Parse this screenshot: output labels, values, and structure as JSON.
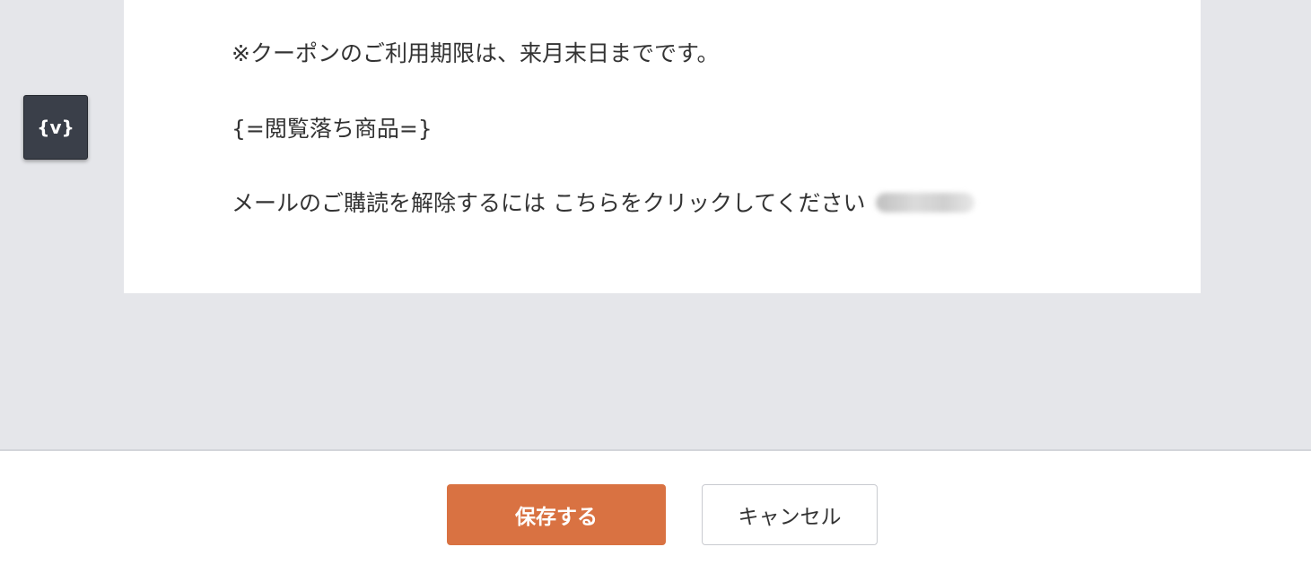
{
  "editor": {
    "variable_button_label": "{v}",
    "body": {
      "coupon_note": "※クーポンのご利用期限は、来月末日までです。",
      "browsed_products_tag": "{=閲覧落ち商品=}",
      "unsubscribe_text": "メールのご購読を解除するには こちらをクリックしてください"
    }
  },
  "footer": {
    "save_label": "保存する",
    "cancel_label": "キャンセル"
  },
  "colors": {
    "editor_background": "#e5e6ea",
    "save_button": "#d97242",
    "variable_button": "#3a3f49"
  }
}
